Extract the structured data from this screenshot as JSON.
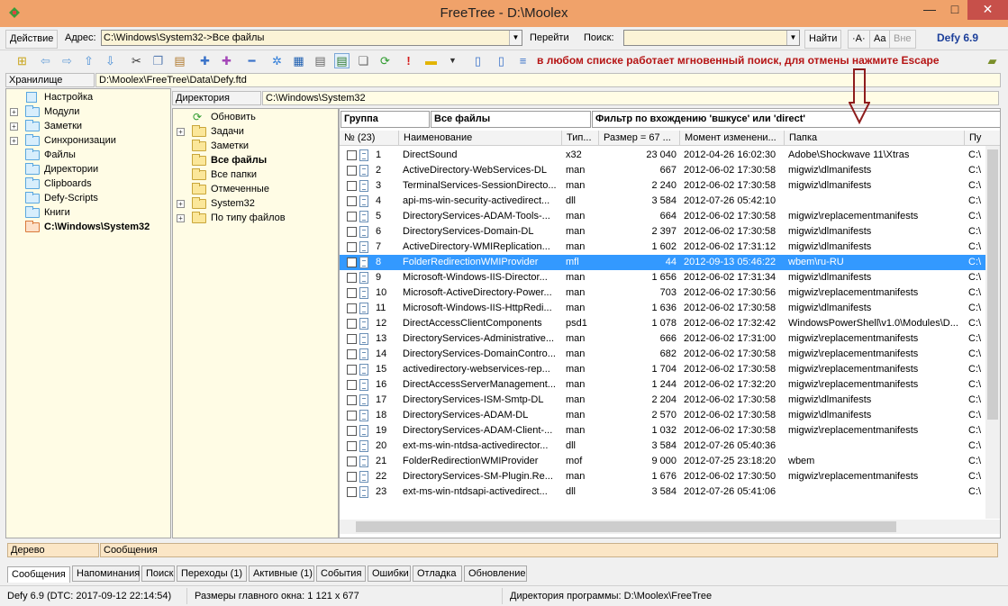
{
  "window": {
    "title": "FreeTree - D:\\Moolex",
    "min": "—",
    "max": "□",
    "close": "✕"
  },
  "addressbar": {
    "action": "Действие",
    "address_label": "Адрес:",
    "address_value": "C:\\Windows\\System32->Все файлы",
    "go": "Перейти",
    "search_label": "Поиск:",
    "search_value": "",
    "find": "Найти",
    "font_a": "·A·",
    "font_aa": "Aa",
    "font_bne": "Вне",
    "version": "Defy 6.9"
  },
  "toolbar": {
    "hint": "в любом списке работает мгновенный поиск, для отмены нажмите Escape",
    "icons": [
      "add-icon",
      "back-icon",
      "forward-icon",
      "up-icon",
      "down-icon",
      "cut-icon",
      "copy-icon",
      "paste-icon",
      "add-item-icon",
      "plugin-icon",
      "minus-icon",
      "gear-icon",
      "calendar-icon",
      "document-icon",
      "page-icon",
      "pages-icon",
      "refresh-icon",
      "exclamation-icon",
      "highlight-icon",
      "dropdown-icon",
      "column-icon",
      "column-icon-2",
      "book-icon"
    ]
  },
  "storage": {
    "label": "Хранилище",
    "path": "D:\\Moolex\\FreeTree\\Data\\Defy.ftd"
  },
  "left_tree": [
    {
      "label": "Настройка",
      "exp": "",
      "icon": "settings",
      "bold": false
    },
    {
      "label": "Модули",
      "exp": "+",
      "icon": "folder",
      "bold": false
    },
    {
      "label": "Заметки",
      "exp": "+",
      "icon": "folder",
      "bold": false
    },
    {
      "label": "Синхронизации",
      "exp": "+",
      "icon": "folder",
      "bold": false
    },
    {
      "label": "Файлы",
      "exp": "",
      "icon": "folder",
      "bold": false
    },
    {
      "label": "Директории",
      "exp": "",
      "icon": "folder",
      "bold": false
    },
    {
      "label": "Clipboards",
      "exp": "",
      "icon": "folder",
      "bold": false
    },
    {
      "label": "Defy-Scripts",
      "exp": "",
      "icon": "folder",
      "bold": false
    },
    {
      "label": "Книги",
      "exp": "",
      "icon": "folder",
      "bold": false
    },
    {
      "label": "C:\\Windows\\System32",
      "exp": "",
      "icon": "folder-red",
      "bold": true
    }
  ],
  "directory": {
    "label": "Директория",
    "path": "C:\\Windows\\System32"
  },
  "mid_tree": [
    {
      "label": "Обновить",
      "exp": "",
      "icon": "refresh",
      "bold": false
    },
    {
      "label": "Задачи",
      "exp": "+",
      "icon": "folder-yel",
      "bold": false
    },
    {
      "label": "Заметки",
      "exp": "",
      "icon": "folder-yel",
      "bold": false
    },
    {
      "label": "Все файлы",
      "exp": "",
      "icon": "folder-yel",
      "bold": true
    },
    {
      "label": "Все папки",
      "exp": "",
      "icon": "folder-yel",
      "bold": false
    },
    {
      "label": "Отмеченные",
      "exp": "",
      "icon": "folder-yel",
      "bold": false
    },
    {
      "label": "System32",
      "exp": "+",
      "icon": "folder-yel",
      "bold": false
    },
    {
      "label": "По типу файлов",
      "exp": "+",
      "icon": "folder-yel",
      "bold": false
    }
  ],
  "grid": {
    "group_label": "Группа",
    "group_value": "Все файлы",
    "filter": "Фильтр по вхождению 'вшкусе' или 'direct'",
    "columns": [
      "№ (23)",
      "Наименование",
      "Тип...",
      "Размер = 67 ...",
      "Момент изменени...",
      "Папка",
      "Пу"
    ],
    "rows": [
      [
        "1",
        "DirectSound",
        "x32",
        "23 040",
        "2012-04-26 16:02:30",
        "Adobe\\Shockwave 11\\Xtras",
        "C:\\"
      ],
      [
        "2",
        "ActiveDirectory-WebServices-DL",
        "man",
        "667",
        "2012-06-02 17:30:58",
        "migwiz\\dlmanifests",
        "C:\\"
      ],
      [
        "3",
        "TerminalServices-SessionDirecto...",
        "man",
        "2 240",
        "2012-06-02 17:30:58",
        "migwiz\\dlmanifests",
        "C:\\"
      ],
      [
        "4",
        "api-ms-win-security-activedirect...",
        "dll",
        "3 584",
        "2012-07-26 05:42:10",
        "",
        "C:\\"
      ],
      [
        "5",
        "DirectoryServices-ADAM-Tools-...",
        "man",
        "664",
        "2012-06-02 17:30:58",
        "migwiz\\replacementmanifests",
        "C:\\"
      ],
      [
        "6",
        "DirectoryServices-Domain-DL",
        "man",
        "2 397",
        "2012-06-02 17:30:58",
        "migwiz\\dlmanifests",
        "C:\\"
      ],
      [
        "7",
        "ActiveDirectory-WMIReplication...",
        "man",
        "1 602",
        "2012-06-02 17:31:12",
        "migwiz\\dlmanifests",
        "C:\\"
      ],
      [
        "8",
        "FolderRedirectionWMIProvider",
        "mfl",
        "44",
        "2012-09-13 05:46:22",
        "wbem\\ru-RU",
        "C:\\"
      ],
      [
        "9",
        "Microsoft-Windows-IIS-Director...",
        "man",
        "1 656",
        "2012-06-02 17:31:34",
        "migwiz\\dlmanifests",
        "C:\\"
      ],
      [
        "10",
        "Microsoft-ActiveDirectory-Power...",
        "man",
        "703",
        "2012-06-02 17:30:56",
        "migwiz\\replacementmanifests",
        "C:\\"
      ],
      [
        "11",
        "Microsoft-Windows-IIS-HttpRedi...",
        "man",
        "1 636",
        "2012-06-02 17:30:58",
        "migwiz\\dlmanifests",
        "C:\\"
      ],
      [
        "12",
        "DirectAccessClientComponents",
        "psd1",
        "1 078",
        "2012-06-02 17:32:42",
        "WindowsPowerShell\\v1.0\\Modules\\D...",
        "C:\\"
      ],
      [
        "13",
        "DirectoryServices-Administrative...",
        "man",
        "666",
        "2012-06-02 17:31:00",
        "migwiz\\replacementmanifests",
        "C:\\"
      ],
      [
        "14",
        "DirectoryServices-DomainContro...",
        "man",
        "682",
        "2012-06-02 17:30:58",
        "migwiz\\replacementmanifests",
        "C:\\"
      ],
      [
        "15",
        "activedirectory-webservices-rep...",
        "man",
        "1 704",
        "2012-06-02 17:30:58",
        "migwiz\\replacementmanifests",
        "C:\\"
      ],
      [
        "16",
        "DirectAccessServerManagement...",
        "man",
        "1 244",
        "2012-06-02 17:32:20",
        "migwiz\\replacementmanifests",
        "C:\\"
      ],
      [
        "17",
        "DirectoryServices-ISM-Smtp-DL",
        "man",
        "2 204",
        "2012-06-02 17:30:58",
        "migwiz\\dlmanifests",
        "C:\\"
      ],
      [
        "18",
        "DirectoryServices-ADAM-DL",
        "man",
        "2 570",
        "2012-06-02 17:30:58",
        "migwiz\\dlmanifests",
        "C:\\"
      ],
      [
        "19",
        "DirectoryServices-ADAM-Client-...",
        "man",
        "1 032",
        "2012-06-02 17:30:58",
        "migwiz\\replacementmanifests",
        "C:\\"
      ],
      [
        "20",
        "ext-ms-win-ntdsa-activedirector...",
        "dll",
        "3 584",
        "2012-07-26 05:40:36",
        "",
        "C:\\"
      ],
      [
        "21",
        "FolderRedirectionWMIProvider",
        "mof",
        "9 000",
        "2012-07-25 23:18:20",
        "wbem",
        "C:\\"
      ],
      [
        "22",
        "DirectoryServices-SM-Plugin.Re...",
        "man",
        "1 676",
        "2012-06-02 17:30:50",
        "migwiz\\replacementmanifests",
        "C:\\"
      ],
      [
        "23",
        "ext-ms-win-ntdsapi-activedirect...",
        "dll",
        "3 584",
        "2012-07-26 05:41:06",
        "",
        "C:\\"
      ]
    ],
    "selected_row": 8
  },
  "message_bar": {
    "tree": "Дерево",
    "messages": "Сообщения"
  },
  "tabs": [
    "Сообщения",
    "Напоминания",
    "Поиск",
    "Переходы (1)",
    "Активные (1)",
    "События",
    "Ошибки",
    "Отладка",
    "Обновление"
  ],
  "status": {
    "left": "Defy 6.9 (DTC: 2017-09-12 22:14:54)",
    "mid": "Размеры главного окна: 1 121 x 677",
    "right": "Директория программы: D:\\Moolex\\FreeTree"
  }
}
